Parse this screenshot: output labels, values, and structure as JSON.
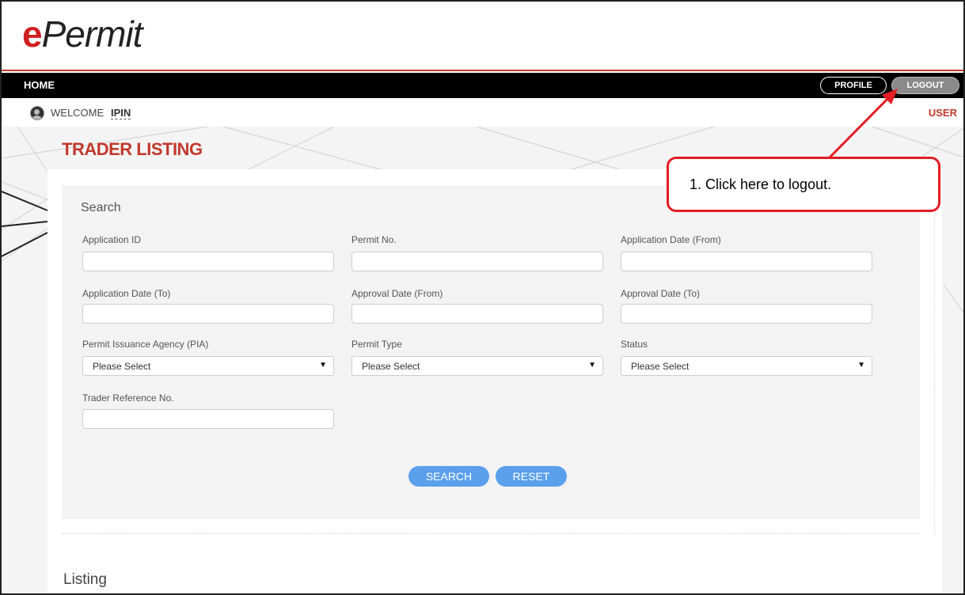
{
  "logo": {
    "e": "e",
    "rest": "Permit"
  },
  "nav": {
    "home": "HOME",
    "profile": "PROFILE",
    "logout": "LOGOUT"
  },
  "welcome": {
    "label": "WELCOME",
    "user": "IPIN",
    "user_link": "USER"
  },
  "page": {
    "title": "TRADER LISTING"
  },
  "search": {
    "title": "Search",
    "fields": {
      "application_id": {
        "label": "Application ID",
        "value": ""
      },
      "permit_no": {
        "label": "Permit No.",
        "value": ""
      },
      "app_date_from": {
        "label": "Application Date (From)",
        "value": ""
      },
      "app_date_to": {
        "label": "Application Date (To)",
        "value": ""
      },
      "approval_date_from": {
        "label": "Approval Date (From)",
        "value": ""
      },
      "approval_date_to": {
        "label": "Approval Date (To)",
        "value": ""
      },
      "pia": {
        "label": "Permit Issuance Agency (PIA)",
        "selected": "Please Select"
      },
      "permit_type": {
        "label": "Permit Type",
        "selected": "Please Select"
      },
      "status": {
        "label": "Status",
        "selected": "Please Select"
      },
      "trader_ref": {
        "label": "Trader Reference No.",
        "value": ""
      }
    },
    "search_button": "SEARCH",
    "reset_button": "RESET"
  },
  "listing": {
    "title": "Listing"
  },
  "callout": {
    "text": "1.  Click here to logout."
  },
  "colors": {
    "brand_red": "#c0392b",
    "button_blue": "#5aa0ea",
    "callout_red": "#e31c23",
    "nav_black": "#000000"
  },
  "icons": {
    "avatar": "user-avatar-icon",
    "dropdown": "dropdown-arrow-icon"
  }
}
